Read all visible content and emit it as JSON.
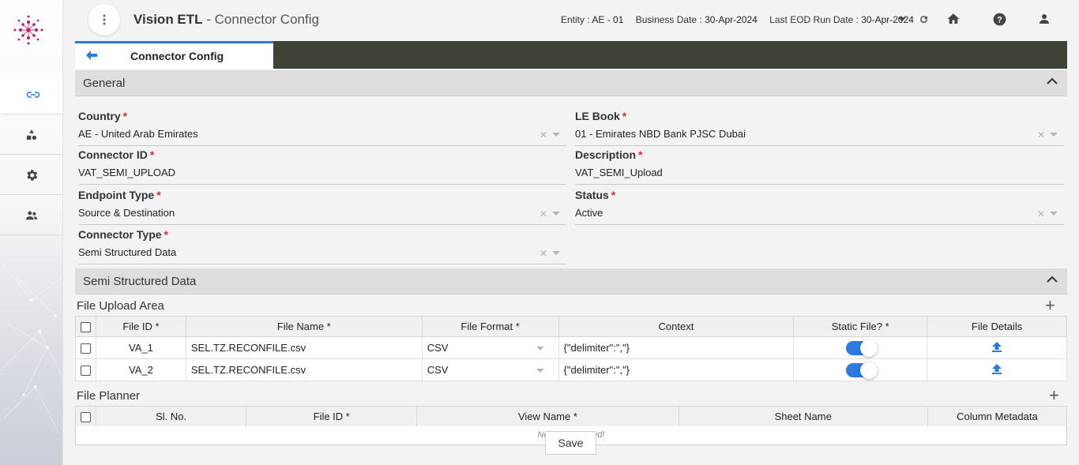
{
  "header": {
    "app_name": "Vision ETL",
    "page_name": " - Connector Config",
    "entity_label": "Entity : ",
    "entity_value": "AE - 01",
    "business_date_label": "Business Date : ",
    "business_date_value": "30-Apr-2024",
    "eod_label": "Last EOD Run Date : ",
    "eod_value": "30-Apr-2024"
  },
  "sidebar": {
    "items": [
      {
        "icon": "link-icon"
      },
      {
        "icon": "shapes-icon"
      },
      {
        "icon": "gear-icon"
      },
      {
        "icon": "users-icon"
      }
    ]
  },
  "tab": {
    "label": "Connector Config"
  },
  "general": {
    "title": "General",
    "country_label": "Country",
    "country_value": "AE - United Arab Emirates",
    "lebook_label": "LE Book",
    "lebook_value": "01 - Emirates NBD Bank PJSC Dubai",
    "connector_id_label": "Connector ID",
    "connector_id_value": "VAT_SEMI_UPLOAD",
    "description_label": "Description",
    "description_value": "VAT_SEMI_Upload",
    "endpoint_label": "Endpoint Type",
    "endpoint_value": "Source & Destination",
    "status_label": "Status",
    "status_value": "Active",
    "connector_type_label": "Connector Type",
    "connector_type_value": "Semi Structured Data",
    "required_mark": "*"
  },
  "semi": {
    "title": "Semi Structured Data",
    "upload_title": "File Upload Area",
    "upload_columns": [
      "File ID *",
      "File Name *",
      "File Format *",
      "Context",
      "Static File? *",
      "File Details"
    ],
    "upload_rows": [
      {
        "file_id": "VA_1",
        "file_name": "SEL.TZ.RECONFILE.csv",
        "format": "CSV",
        "context": "{\"delimiter\":\",\"}",
        "static": true
      },
      {
        "file_id": "VA_2",
        "file_name": "SEL.TZ.RECONFILE.csv",
        "format": "CSV",
        "context": "{\"delimiter\":\",\"}",
        "static": true
      }
    ],
    "planner_title": "File Planner",
    "planner_columns": [
      "Sl. No.",
      "File ID *",
      "View Name *",
      "Sheet Name",
      "Column Metadata"
    ],
    "no_record": "No record added!"
  },
  "actions": {
    "save_label": "Save"
  },
  "colors": {
    "accent": "#2a7ae2",
    "tabbar": "#3e4435",
    "required": "#d32f2f",
    "logo": "#c2185b"
  }
}
